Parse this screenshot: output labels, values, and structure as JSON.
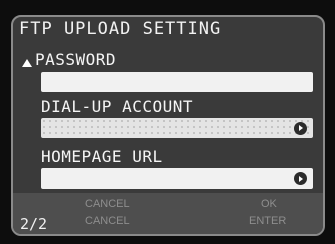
{
  "title": "FTP UPLOAD SETTING",
  "fields": [
    {
      "label": "PASSWORD",
      "value": ""
    },
    {
      "label": "DIAL-UP ACCOUNT",
      "value": ""
    },
    {
      "label": "HOMEPAGE URL",
      "value": ""
    }
  ],
  "footer": {
    "page": "2/2",
    "row1_left": "CANCEL",
    "row1_right": "OK",
    "row2_left": "CANCEL",
    "row2_right": "ENTER"
  },
  "icons": {
    "scroll_up": "up-triangle-icon",
    "select": "right-arrow-circle-icon"
  }
}
